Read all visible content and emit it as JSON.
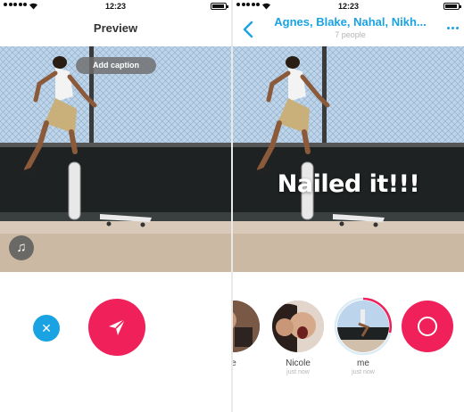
{
  "status_bar": {
    "time": "12:23"
  },
  "preview_screen": {
    "title": "Preview",
    "caption_button": "Add caption",
    "music_icon": "♫",
    "close_icon": "✕"
  },
  "chat_screen": {
    "group_name": "Agnes, Blake, Nahal, Nikh...",
    "member_count": "7 people",
    "caption_text": "Nailed it!!!",
    "recipients": [
      {
        "label": "e",
        "time": ""
      },
      {
        "label": "Nicole",
        "time": "just now"
      },
      {
        "label": "me",
        "time": "just now"
      }
    ]
  },
  "colors": {
    "accent_blue": "#1aa3e3",
    "accent_red": "#f0215a"
  }
}
